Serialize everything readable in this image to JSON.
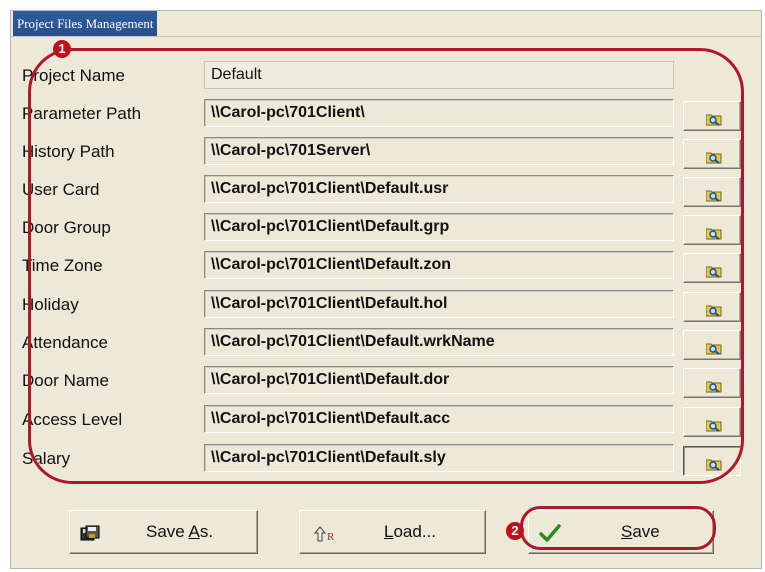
{
  "window": {
    "title": "Project Files Management"
  },
  "badges": {
    "one": "1",
    "two": "2"
  },
  "rows": [
    {
      "label": "Project Name",
      "value": "Default"
    },
    {
      "label": "Parameter Path",
      "value": "\\\\Carol-pc\\701Client\\"
    },
    {
      "label": "History Path",
      "value": "\\\\Carol-pc\\701Server\\"
    },
    {
      "label": "User Card",
      "value": "\\\\Carol-pc\\701Client\\Default.usr"
    },
    {
      "label": "Door Group",
      "value": "\\\\Carol-pc\\701Client\\Default.grp"
    },
    {
      "label": "Time Zone",
      "value": "\\\\Carol-pc\\701Client\\Default.zon"
    },
    {
      "label": "Holiday",
      "value": "\\\\Carol-pc\\701Client\\Default.hol"
    },
    {
      "label": "Attendance",
      "value": "\\\\Carol-pc\\701Client\\Default.wrkName"
    },
    {
      "label": "Door Name",
      "value": "\\\\Carol-pc\\701Client\\Default.dor"
    },
    {
      "label": "Access Level",
      "value": "\\\\Carol-pc\\701Client\\Default.acc"
    },
    {
      "label": "Salary",
      "value": "\\\\Carol-pc\\701Client\\Default.sly"
    }
  ],
  "buttons": {
    "save_as": {
      "pre": "Save ",
      "mnemonic": "A",
      "post": "s."
    },
    "load": {
      "pre": "",
      "mnemonic": "L",
      "post": "oad...",
      "icon_text": "R"
    },
    "save": {
      "pre": "",
      "mnemonic": "S",
      "post": "ave"
    }
  },
  "icons": {
    "browse": "folder-search-icon",
    "save_as": "floppy-disk-icon",
    "load": "load-arrow-icon",
    "save": "checkmark-icon"
  },
  "colors": {
    "annotation": "#b0172a",
    "title_bar": "#2f5d9f",
    "check": "#2e8b1e"
  }
}
